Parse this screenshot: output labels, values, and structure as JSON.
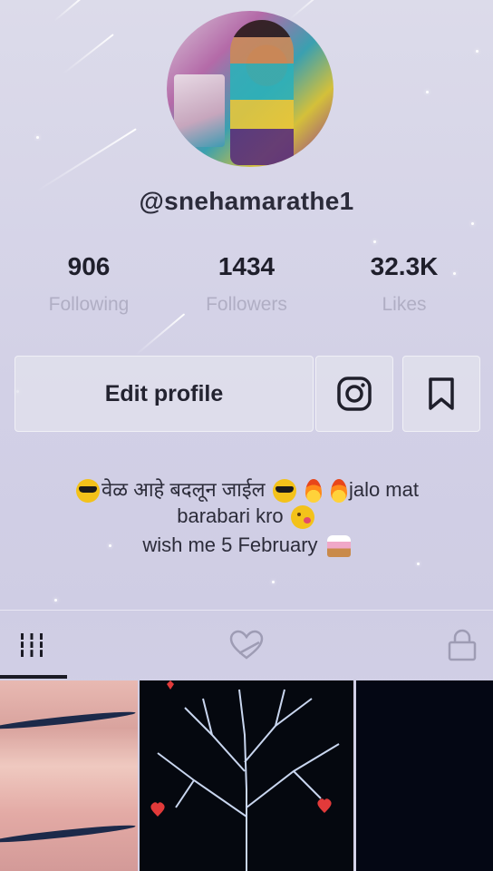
{
  "profile": {
    "username": "@snehamarathe1"
  },
  "stats": [
    {
      "value": "906",
      "label": "Following"
    },
    {
      "value": "1434",
      "label": "Followers"
    },
    {
      "value": "32.3K",
      "label": "Likes"
    }
  ],
  "actions": {
    "edit_label": "Edit profile"
  },
  "bio": {
    "line1_marathi": "वेळ आहे बदलून जाईल",
    "line1_tail": "jalo mat",
    "line2": "barabari kro",
    "line3": "wish me 5 February"
  },
  "icons": {
    "instagram": "instagram-icon",
    "bookmark": "bookmark-icon",
    "grid": "grid-icon",
    "liked": "liked-heart-icon",
    "private": "lock-icon"
  },
  "colors": {
    "background": "#d4d2e7",
    "text_primary": "#1f1f2b",
    "text_secondary": "#b0aec4"
  }
}
